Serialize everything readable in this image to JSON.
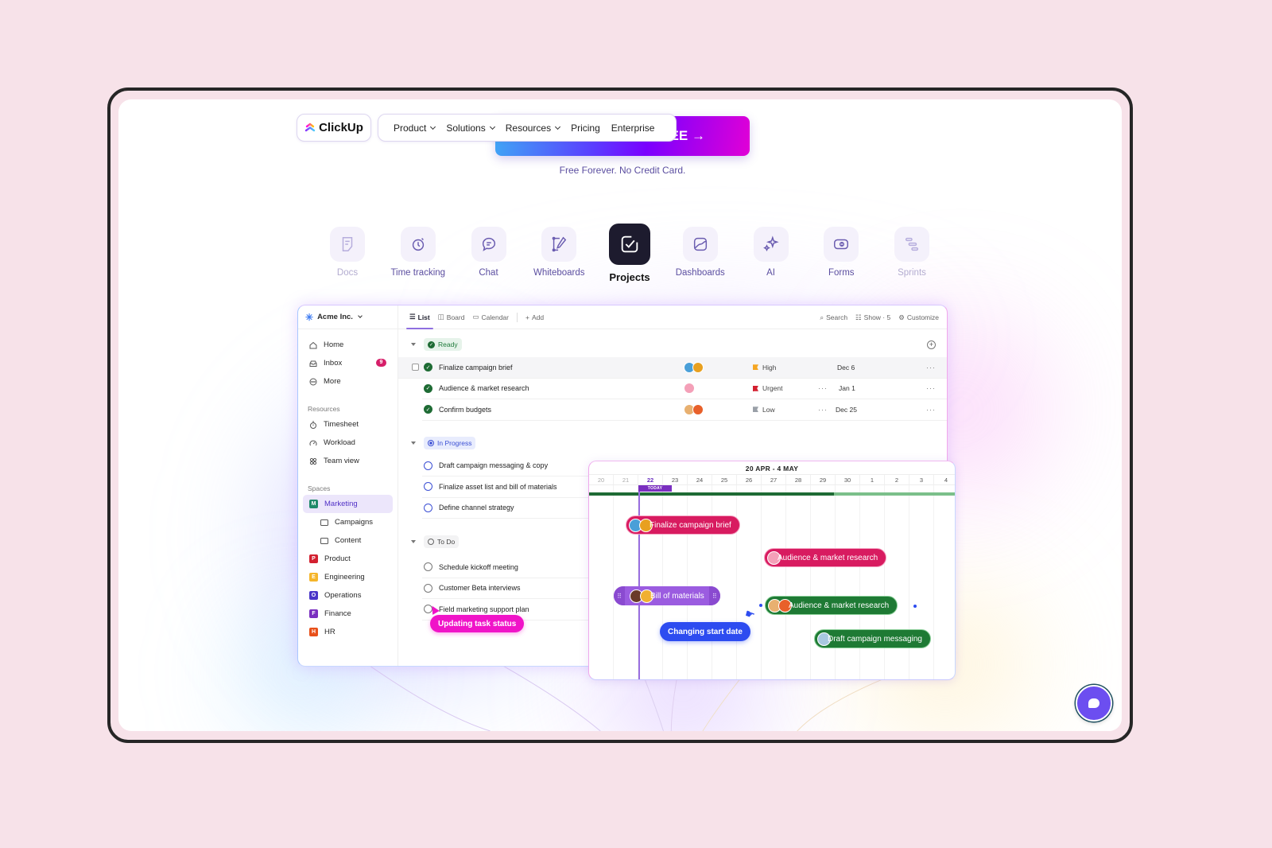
{
  "nav": {
    "logo_text": "ClickUp",
    "items": [
      {
        "label": "Product",
        "dropdown": true
      },
      {
        "label": "Solutions",
        "dropdown": true
      },
      {
        "label": "Resources",
        "dropdown": true
      },
      {
        "label": "Pricing",
        "dropdown": false
      },
      {
        "label": "Enterprise",
        "dropdown": false
      }
    ],
    "cta_visible_text": "EE →",
    "cta_subtext": "Free Forever. No Credit Card."
  },
  "features": [
    {
      "label": "Docs",
      "icon": "docs-icon",
      "state": "dim"
    },
    {
      "label": "Time tracking",
      "icon": "clock-icon",
      "state": "normal"
    },
    {
      "label": "Chat",
      "icon": "chat-icon",
      "state": "normal"
    },
    {
      "label": "Whiteboards",
      "icon": "whiteboard-icon",
      "state": "normal"
    },
    {
      "label": "Projects",
      "icon": "checkbox-icon",
      "state": "active"
    },
    {
      "label": "Dashboards",
      "icon": "chart-icon",
      "state": "normal"
    },
    {
      "label": "AI",
      "icon": "sparkle-icon",
      "state": "normal"
    },
    {
      "label": "Forms",
      "icon": "form-icon",
      "state": "normal"
    },
    {
      "label": "Sprints",
      "icon": "sprints-icon",
      "state": "dim"
    }
  ],
  "app": {
    "workspace": "Acme Inc.",
    "sidebar": {
      "top": [
        {
          "label": "Home",
          "icon": "home-icon"
        },
        {
          "label": "Inbox",
          "icon": "inbox-icon",
          "badge": "9"
        },
        {
          "label": "More",
          "icon": "more-icon"
        }
      ],
      "resources_title": "Resources",
      "resources": [
        {
          "label": "Timesheet",
          "icon": "stopwatch-icon"
        },
        {
          "label": "Workload",
          "icon": "gauge-icon"
        },
        {
          "label": "Team view",
          "icon": "grid-icon"
        }
      ],
      "spaces_title": "Spaces",
      "spaces": [
        {
          "label": "Marketing",
          "letter": "M",
          "color": "#1f8a6a",
          "selected": true
        },
        {
          "label": "Campaigns",
          "folder": true
        },
        {
          "label": "Content",
          "folder": true
        },
        {
          "label": "Product",
          "letter": "P",
          "color": "#d32030"
        },
        {
          "label": "Engineering",
          "letter": "E",
          "color": "#f5b52a"
        },
        {
          "label": "Operations",
          "letter": "O",
          "color": "#4a36c8"
        },
        {
          "label": "Finance",
          "letter": "F",
          "color": "#7a2fc0"
        },
        {
          "label": "HR",
          "letter": "H",
          "color": "#e8501a"
        }
      ]
    },
    "toolbar": {
      "tabs": [
        "List",
        "Board",
        "Calendar"
      ],
      "add": "Add",
      "search": "Search",
      "show": "Show · 5",
      "customize": "Customize"
    },
    "groups": [
      {
        "status": "Ready",
        "tasks": [
          {
            "name": "Finalize campaign brief",
            "priority": "High",
            "priority_color": "#f5a623",
            "due": "Dec 6",
            "avatars": [
              "#4a9fd8",
              "#e8a020"
            ]
          },
          {
            "name": "Audience & market research",
            "priority": "Urgent",
            "priority_color": "#d32030",
            "due": "Jan 1",
            "avatars": [
              "#f4a0b8"
            ]
          },
          {
            "name": "Confirm budgets",
            "priority": "Low",
            "priority_color": "#9aa0a8",
            "due": "Dec 25",
            "avatars": [
              "#e8b070",
              "#e8602a"
            ]
          }
        ]
      },
      {
        "status": "In Progress",
        "tasks": [
          {
            "name": "Draft campaign messaging & copy"
          },
          {
            "name": "Finalize asset list and bill of materials"
          },
          {
            "name": "Define channel strategy"
          }
        ]
      },
      {
        "status": "To Do",
        "tasks": [
          {
            "name": "Schedule kickoff meeting"
          },
          {
            "name": "Customer Beta interviews"
          },
          {
            "name": "Field marketing support plan"
          }
        ]
      }
    ],
    "tooltip_status": "Updating task status"
  },
  "gantt": {
    "range_title": "20 APR - 4 MAY",
    "days": [
      "20",
      "21",
      "22",
      "23",
      "24",
      "25",
      "26",
      "27",
      "28",
      "29",
      "30",
      "1",
      "2",
      "3",
      "4"
    ],
    "today_index": 2,
    "today_label": "TODAY",
    "progress": 0.67,
    "bars": [
      {
        "label": "Finalize campaign brief",
        "color": "pink"
      },
      {
        "label": "Audience & market research",
        "color": "pink"
      },
      {
        "label": "Bill of materials",
        "color": "purple"
      },
      {
        "label": "Audience & market research",
        "color": "green"
      },
      {
        "label": "Draft campaign messaging",
        "color": "green"
      }
    ],
    "tooltip_drag": "Changing start date"
  }
}
